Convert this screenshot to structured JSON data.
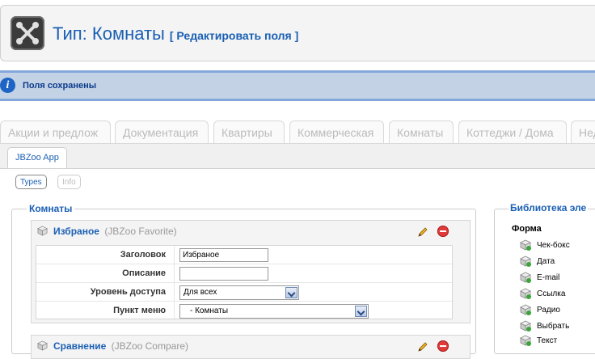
{
  "header": {
    "title": "Тип: Комнаты",
    "edit_link": "[ Редактировать поля ]"
  },
  "message": {
    "text": "Поля сохранены"
  },
  "tabs": [
    {
      "label": "Акции и предлож"
    },
    {
      "label": "Документация"
    },
    {
      "label": "Квартиры"
    },
    {
      "label": "Коммерческая"
    },
    {
      "label": "Комнаты"
    },
    {
      "label": "Коттеджи / Дома"
    },
    {
      "label": "Нед"
    }
  ],
  "subtab": {
    "label": "JBZoo App"
  },
  "pills": {
    "types": "Types",
    "info": "Info"
  },
  "main": {
    "legend": "Комнаты",
    "elements": [
      {
        "name": "Избраное",
        "type": "(JBZoo Favorite)",
        "fields": {
          "title_label": "Заголовок",
          "title_value": "Избраное",
          "desc_label": "Описание",
          "desc_value": "",
          "access_label": "Уровень доступа",
          "access_value": "Для всех",
          "menu_label": "Пункт меню",
          "menu_value": "- Комнаты"
        }
      },
      {
        "name": "Сравнение",
        "type": "(JBZoo Compare)"
      }
    ]
  },
  "library": {
    "title": "Библиотека эле",
    "group": "Форма",
    "items": [
      "Чек-бокс",
      "Дата",
      "E-mail",
      "Ссылка",
      "Радио",
      "Выбрать",
      "Текст"
    ]
  }
}
